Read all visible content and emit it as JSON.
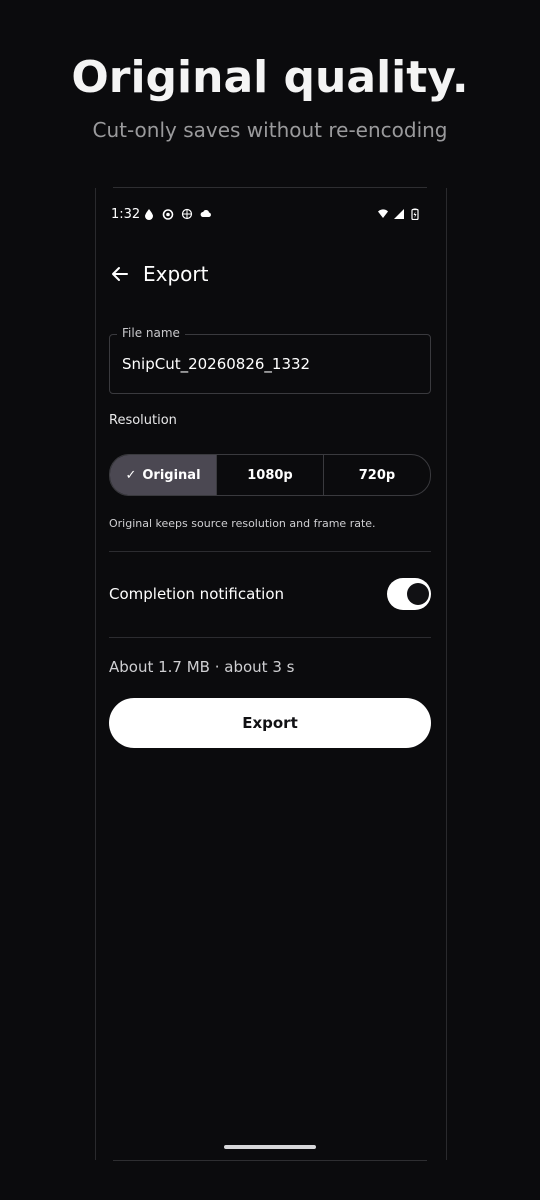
{
  "hero": {
    "title": "Original quality.",
    "subtitle": "Cut-only saves without re-encoding"
  },
  "status_bar": {
    "time": "1:32",
    "left_icons": [
      "drop-icon",
      "camera-icon",
      "globe-icon",
      "cloud-icon"
    ],
    "right_icons": [
      "wifi-icon",
      "signal-icon",
      "battery-icon"
    ]
  },
  "app_bar": {
    "title": "Export",
    "back_icon": "arrow-left-icon"
  },
  "file_name": {
    "label": "File name",
    "value": "SnipCut_20260826_1332"
  },
  "resolution": {
    "label": "Resolution",
    "options": [
      "Original",
      "1080p",
      "720p"
    ],
    "selected": "Original",
    "helper": "Original keeps source resolution and frame rate."
  },
  "notification": {
    "label": "Completion notification",
    "enabled": true
  },
  "estimate": "About 1.7 MB · about 3 s",
  "export_button": "Export",
  "colors": {
    "background": "#0b0b0d",
    "selected_segment": "#4b4852",
    "button": "#ffffff"
  }
}
